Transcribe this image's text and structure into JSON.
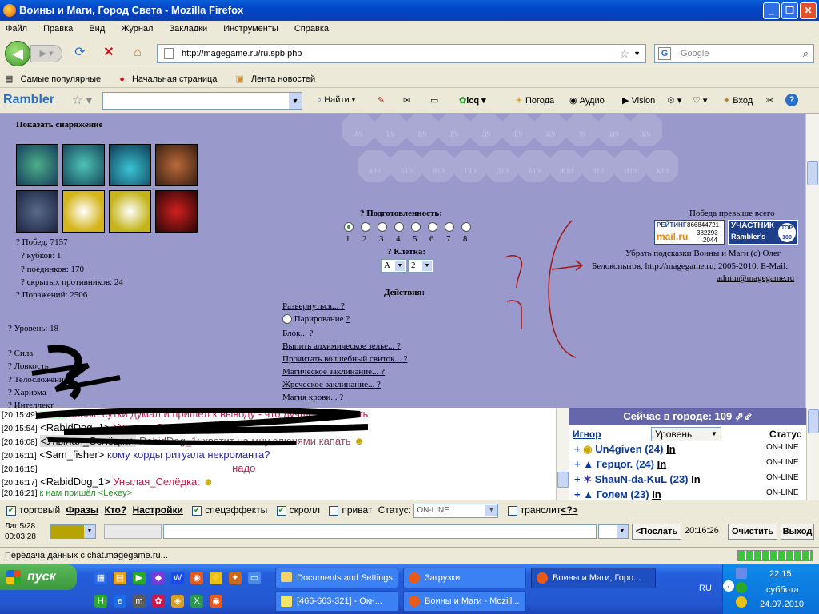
{
  "window": {
    "title": "Воины и Маги, Город Света - Mozilla Firefox"
  },
  "menu": [
    "Файл",
    "Правка",
    "Вид",
    "Журнал",
    "Закладки",
    "Инструменты",
    "Справка"
  ],
  "nav": {
    "url": "http://magegame.ru/ru.spb.php",
    "search_placeholder": "Google"
  },
  "bookmarks": [
    "Самые популярные",
    "Начальная страница",
    "Лента новостей"
  ],
  "rambler": {
    "logo": "Rambler",
    "search_label": "Найти",
    "weather": "Погода",
    "audio": "Аудио",
    "vision": "Vision",
    "login": "Вход",
    "icq": "icq"
  },
  "game": {
    "show_gear": "Показать снаряжение",
    "stats": {
      "wins": "? Побед: 7157",
      "cups": "? кубков: 1",
      "duels": "? поединков: 170",
      "hidden": "? скрытых противников: 24",
      "losses": "? Поражений: 2506",
      "level": "? Уровень: 18",
      "str": "? Сила",
      "agi": "? Ловкость",
      "body": "? Телосложение",
      "cha": "? Харизма",
      "int": "? Интеллект"
    },
    "hex_row1": [
      "А9",
      "Б9",
      "В9",
      "Г9",
      "Д9",
      "Е9",
      "Ж9",
      "З9",
      "И9",
      "К9"
    ],
    "hex_row2": [
      "А10",
      "Б10",
      "В10",
      "Г10",
      "Д10",
      "Е10",
      "Ж10",
      "З10",
      "И10",
      "К10"
    ],
    "readiness_label": "? Подготовленность:",
    "readiness_values": [
      "1",
      "2",
      "3",
      "4",
      "5",
      "6",
      "7",
      "8"
    ],
    "cell_label": "? Клетка:",
    "cell_col": "А",
    "cell_row": "2",
    "actions_label": "Действия:",
    "actions": [
      "Развернуться...",
      "Парирование",
      "Блок...",
      "Выпить алхимическое зелье...",
      "Прочитать волшебный свиток...",
      "Магическое заклинание...",
      "Жреческое заклинание...",
      "Магия крови..."
    ],
    "right_title": "Победа превыше всего",
    "counter_label": "РЕЙТИНГ",
    "counter_values": [
      "866844721",
      "382293",
      "2044"
    ],
    "counter_brand": "mail.ru",
    "top100_a": "УЧАСТНИК",
    "top100_b": "Rambler's",
    "top100_c": "TOP 100",
    "hide_hints": "Убрать подсказки",
    "copyright1": " Воины и Маги (с) Олег",
    "copyright2": "Белокопытов, http://magegame.ru, 2005-2010, E-Mail:",
    "email": "admin@magegame.ru",
    "scribble_q": "?"
  },
  "chat": [
    {
      "time": "[20:15:49]",
      "nick": "Личный",
      "msg": "целые сутки думал и пришёл к выводу - что лучше не тратить"
    },
    {
      "time": "[20:15:54]",
      "nick": "<RabidDog_1>",
      "msg": "Унылая_Селёдка:"
    },
    {
      "time": "[20:16:08]",
      "nick": "<Унылая_Селёдка>",
      "msg": "RabidDog_1: хватит на мну слюнями капать"
    },
    {
      "time": "[20:16:11]",
      "nick": "<Sam_fisher>",
      "msg": "кому корды ритуала некроманта?"
    },
    {
      "time": "[20:16:15]",
      "nick": "",
      "msg": "надо"
    },
    {
      "time": "[20:16:17]",
      "nick": "<RabidDog_1>",
      "msg": "Унылая_Селёдка:"
    },
    {
      "time": "[20:16:21]",
      "nick": "",
      "msg": "к нам пришёл <Lexey>"
    }
  ],
  "users": {
    "header": "Сейчас в городе: 109",
    "col_ignore": "Игнор",
    "col_sort": "Уровень",
    "col_status": "Статус",
    "list": [
      {
        "name": "Un4given (24)",
        "info": "In",
        "status": "ON-LINE"
      },
      {
        "name": "Герцог. (24)",
        "info": "In",
        "status": "ON-LINE"
      },
      {
        "name": "ShauN-da-KuL (23)",
        "info": "In",
        "status": "ON-LINE"
      },
      {
        "name": "Голем (23)",
        "info": "In",
        "status": "ON-LINE"
      }
    ]
  },
  "controls": {
    "trade": "торговый",
    "phrases": "Фразы",
    "who": "Кто?",
    "settings": "Настройки",
    "effects": "спецэффекты",
    "scroll": "скролл",
    "private": "приват",
    "status_label": "Статус:",
    "status_value": "ON-LINE",
    "translit": "транслит",
    "translit_help": "<?>",
    "lag": "Лаг 5/28",
    "elapsed": "00:03:28",
    "send": "<Послать",
    "time": "20:16:26",
    "clear": "Очистить",
    "exit": "Выход"
  },
  "statusbar": "Передача данных с chat.magegame.ru...",
  "taskbar": {
    "start": "пуск",
    "buttons": [
      "Documents and Settings",
      "Загрузки",
      "Воины и Маги, Горо...",
      "[466-663-321] - Окн...",
      "Воины и Маги - Mozill..."
    ],
    "lang": "RU",
    "clock": "22:15",
    "day": "суббота",
    "date": "24.07.2010"
  }
}
